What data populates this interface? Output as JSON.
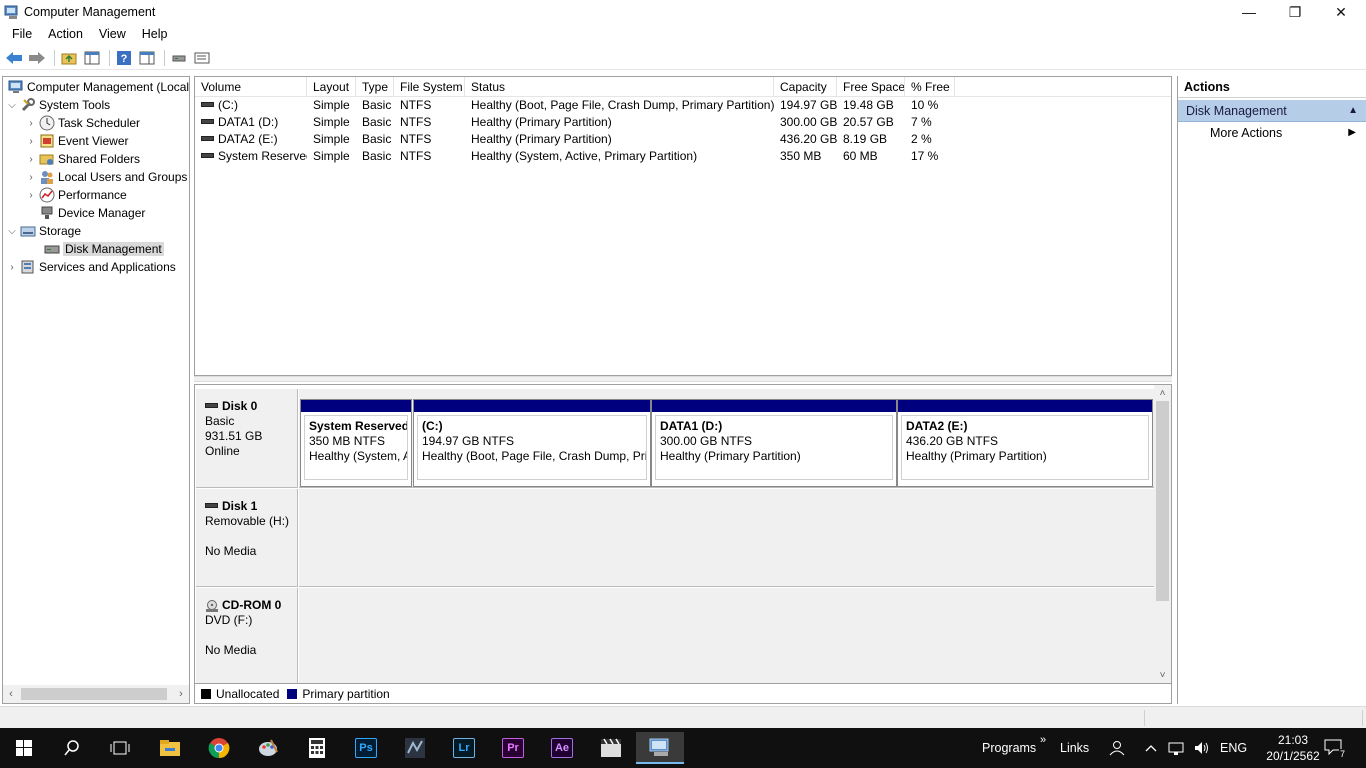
{
  "window": {
    "title": "Computer Management",
    "minimize_glyph": "—",
    "restore_glyph": "❐",
    "close_glyph": "✕"
  },
  "menu": [
    "File",
    "Action",
    "View",
    "Help"
  ],
  "toolbar_icons": [
    "back-arrow-icon",
    "forward-arrow-icon",
    "up-folder-icon",
    "show-hide-tree-icon",
    "help-icon",
    "properties-icon",
    "connect-icon",
    "settings-icon"
  ],
  "tree": {
    "root": "Computer Management (Local",
    "system_tools": "System Tools",
    "task_scheduler": "Task Scheduler",
    "event_viewer": "Event Viewer",
    "shared_folders": "Shared Folders",
    "local_users": "Local Users and Groups",
    "performance": "Performance",
    "device_manager": "Device Manager",
    "storage": "Storage",
    "disk_management": "Disk Management",
    "services": "Services and Applications"
  },
  "volumes": {
    "headers": [
      "Volume",
      "Layout",
      "Type",
      "File System",
      "Status",
      "Capacity",
      "Free Space",
      "% Free"
    ],
    "rows": [
      [
        "(C:)",
        "Simple",
        "Basic",
        "NTFS",
        "Healthy (Boot, Page File, Crash Dump, Primary Partition)",
        "194.97 GB",
        "19.48 GB",
        "10 %"
      ],
      [
        "DATA1 (D:)",
        "Simple",
        "Basic",
        "NTFS",
        "Healthy (Primary Partition)",
        "300.00 GB",
        "20.57 GB",
        "7 %"
      ],
      [
        "DATA2 (E:)",
        "Simple",
        "Basic",
        "NTFS",
        "Healthy (Primary Partition)",
        "436.20 GB",
        "8.19 GB",
        "2 %"
      ],
      [
        "System Reserved",
        "Simple",
        "Basic",
        "NTFS",
        "Healthy (System, Active, Primary Partition)",
        "350 MB",
        "60 MB",
        "17 %"
      ]
    ]
  },
  "disks": {
    "disk0": {
      "name": "Disk 0",
      "type": "Basic",
      "size": "931.51 GB",
      "state": "Online",
      "partitions": [
        {
          "title": "System Reserved",
          "size": "350 MB NTFS",
          "status": "Healthy (System, A"
        },
        {
          "title": "(C:)",
          "size": "194.97 GB NTFS",
          "status": "Healthy (Boot, Page File, Crash Dump, Prir"
        },
        {
          "title": "DATA1  (D:)",
          "size": "300.00 GB NTFS",
          "status": "Healthy (Primary Partition)"
        },
        {
          "title": "DATA2  (E:)",
          "size": "436.20 GB NTFS",
          "status": "Healthy (Primary Partition)"
        }
      ]
    },
    "disk1": {
      "name": "Disk 1",
      "type": "Removable (H:)",
      "state": "No Media"
    },
    "cdrom0": {
      "name": "CD-ROM 0",
      "type": "DVD (F:)",
      "state": "No Media"
    }
  },
  "legend": {
    "unallocated": "Unallocated",
    "primary": "Primary partition",
    "unallocated_color": "#000000",
    "primary_color": "#00007f"
  },
  "actions": {
    "header": "Actions",
    "section": "Disk Management",
    "more": "More Actions"
  },
  "taskbar": {
    "programs": "Programs",
    "links": "Links",
    "lang": "ENG",
    "time": "21:03",
    "date": "20/1/2562",
    "notifications": "7",
    "apps": {
      "ps": "Ps",
      "lr": "Lr",
      "pr": "Pr",
      "ae": "Ae"
    }
  }
}
